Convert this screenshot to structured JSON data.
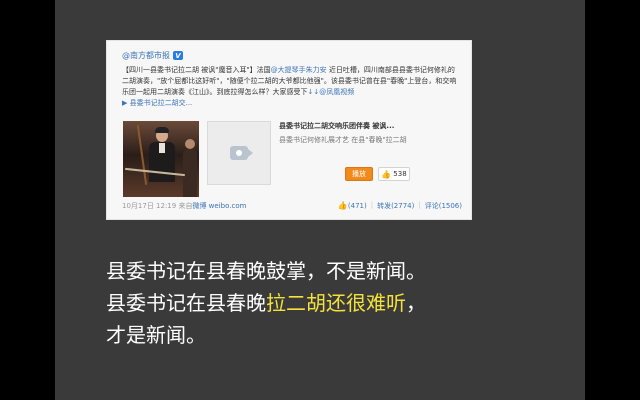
{
  "post": {
    "author": "@南方都市报",
    "verified_badge": "V",
    "text_part1": "【四川一县委书记拉二胡 被讽\"魔音入耳\"】法国",
    "text_mention1": "@大提琴手朱力安",
    "text_part2": " 近日吐槽，四川南部县县委书记何修礼的二胡演奏，\"放个屁都比这好听\"，\"随便个拉二胡的大爷都比他强\"。该县委书记曾在县\"春晚\"上登台，和交响乐团一起用二胡演奏《江山》。到底拉得怎么样？大家感受下",
    "text_mention2": "↓↓@凤凰视频",
    "video_link": "县委书记拉二胡交...",
    "card": {
      "title": "县委书记拉二胡交响乐团伴奏 被讽...",
      "desc": "县委书记何修礼展才艺 在县\"春晚\"拉二胡",
      "play_label": "播放",
      "like_count": "538"
    },
    "footer": {
      "time": "10月17日 12:19",
      "from_prefix": "来自",
      "source": "微博 weibo.com",
      "likes": "(471)",
      "repost": "转发(2774)",
      "comment": "评论(1506)"
    }
  },
  "caption": {
    "line1": "县委书记在县春晚鼓掌，不是新闻。",
    "line2_pre": "县委书记在县春晚",
    "line2_hl": "拉二胡还很难听",
    "line2_post": "，",
    "line3": "才是新闻。"
  },
  "colors": {
    "background": "#000000",
    "slide": "#3a3a3a",
    "highlight": "#f2e23a",
    "link": "#3b73b7",
    "play_button": "#f08a1a"
  },
  "icons": [
    "verified-icon",
    "video-icon",
    "thumb-up-icon"
  ]
}
